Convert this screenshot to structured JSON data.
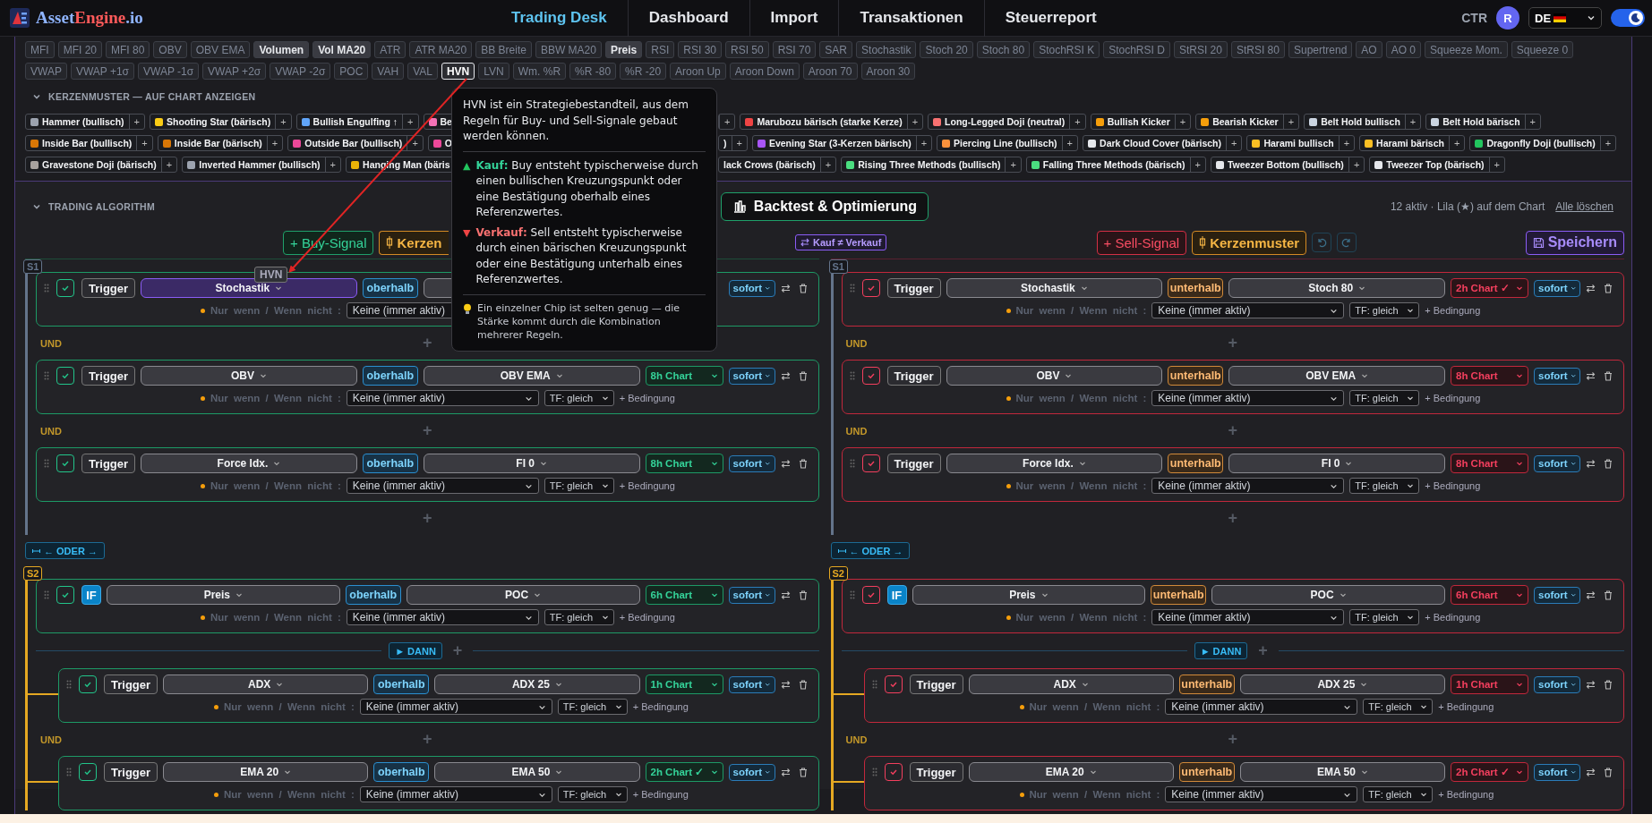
{
  "header": {
    "logo": [
      "Asset",
      "Engine",
      ".io"
    ],
    "nav": [
      {
        "label": "Trading Desk",
        "selected": true
      },
      {
        "label": "Dashboard",
        "selected": false
      },
      {
        "label": "Import",
        "selected": false
      },
      {
        "label": "Transaktionen",
        "selected": false
      },
      {
        "label": "Steuerreport",
        "selected": false
      }
    ],
    "user_code": "CTR",
    "avatar": "R",
    "language": "DE",
    "dark_mode": true
  },
  "indicator_rows": [
    [
      {
        "label": "MFI",
        "active": false,
        "selected": false
      },
      {
        "label": "MFI 20",
        "active": false,
        "selected": false
      },
      {
        "label": "MFI 80",
        "active": false,
        "selected": false
      },
      {
        "label": "OBV",
        "active": false,
        "selected": false
      },
      {
        "label": "OBV EMA",
        "active": false,
        "selected": false
      },
      {
        "label": "Volumen",
        "active": true,
        "selected": false
      },
      {
        "label": "Vol MA20",
        "active": true,
        "selected": false
      },
      {
        "label": "ATR",
        "active": false,
        "selected": false
      },
      {
        "label": "ATR MA20",
        "active": false,
        "selected": false
      },
      {
        "label": "BB Breite",
        "active": false,
        "selected": false
      },
      {
        "label": "BBW MA20",
        "active": false,
        "selected": false
      },
      {
        "label": "Preis",
        "active": true,
        "selected": false
      },
      {
        "label": "RSI",
        "active": false,
        "selected": false
      },
      {
        "label": "RSI 30",
        "active": false,
        "selected": false
      },
      {
        "label": "RSI 50",
        "active": false,
        "selected": false
      },
      {
        "label": "RSI 70",
        "active": false,
        "selected": false
      },
      {
        "label": "SAR",
        "active": false,
        "selected": false
      },
      {
        "label": "Stochastik",
        "active": false,
        "selected": false
      },
      {
        "label": "Stoch 20",
        "active": false,
        "selected": false
      },
      {
        "label": "Stoch 80",
        "active": false,
        "selected": false
      },
      {
        "label": "StochRSI K",
        "active": false,
        "selected": false
      },
      {
        "label": "StochRSI D",
        "active": false,
        "selected": false
      },
      {
        "label": "StRSI 20",
        "active": false,
        "selected": false
      },
      {
        "label": "StRSI 80",
        "active": false,
        "selected": false
      },
      {
        "label": "Supertrend",
        "active": false,
        "selected": false
      },
      {
        "label": "AO",
        "active": false,
        "selected": false
      },
      {
        "label": "AO 0",
        "active": false,
        "selected": false
      },
      {
        "label": "Squeeze Mom.",
        "active": false,
        "selected": false
      },
      {
        "label": "Squeeze 0",
        "active": false,
        "selected": false
      }
    ],
    [
      {
        "label": "VWAP",
        "active": false,
        "selected": false
      },
      {
        "label": "VWAP +1σ",
        "active": false,
        "selected": false
      },
      {
        "label": "VWAP -1σ",
        "active": false,
        "selected": false
      },
      {
        "label": "VWAP +2σ",
        "active": false,
        "selected": false
      },
      {
        "label": "VWAP -2σ",
        "active": false,
        "selected": false
      },
      {
        "label": "POC",
        "active": false,
        "selected": false
      },
      {
        "label": "VAH",
        "active": false,
        "selected": false
      },
      {
        "label": "VAL",
        "active": false,
        "selected": false
      },
      {
        "label": "HVN",
        "active": false,
        "selected": true
      },
      {
        "label": "LVN",
        "active": false,
        "selected": false
      },
      {
        "label": "Wm. %R",
        "active": false,
        "selected": false
      },
      {
        "label": "%R -80",
        "active": false,
        "selected": false
      },
      {
        "label": "%R -20",
        "active": false,
        "selected": false
      },
      {
        "label": "Aroon Up",
        "active": false,
        "selected": false
      },
      {
        "label": "Aroon Down",
        "active": false,
        "selected": false
      },
      {
        "label": "Aroon 70",
        "active": false,
        "selected": false
      },
      {
        "label": "Aroon 30",
        "active": false,
        "selected": false
      }
    ]
  ],
  "patterns": {
    "title": "KERZENMUSTER — AUF CHART ANZEIGEN",
    "expanded": true,
    "rows": [
      {
        "before": [
          {
            "label": "Hammer (bullisch)",
            "color": "#9ca3af",
            "add": "+"
          },
          {
            "label": "Shooting Star (bärisch)",
            "color": "#facc15",
            "add": "+"
          },
          {
            "label": "Bullish Engulfing ↑",
            "color": "#60a5fa",
            "add": "+"
          },
          {
            "label": "Be",
            "color": "#f472b6"
          }
        ],
        "after": [
          {
            "add": "+"
          },
          {
            "label": "Marubozu bärisch (starke Kerze)",
            "color": "#ef4444",
            "add": "+"
          },
          {
            "label": "Long-Legged Doji (neutral)",
            "color": "#f87171",
            "add": "+"
          },
          {
            "label": "Bullish Kicker",
            "color": "#f59e0b",
            "add": "+"
          },
          {
            "label": "Bearish Kicker",
            "color": "#f59e0b",
            "add": "+"
          },
          {
            "label": "Belt Hold bullisch",
            "color": "#cbd5e1",
            "add": "+"
          },
          {
            "label": "Belt Hold bärisch",
            "color": "#cbd5e1",
            "add": "+"
          }
        ]
      },
      {
        "before": [
          {
            "label": "Inside Bar (bullisch)",
            "color": "#d97706",
            "add": "+"
          },
          {
            "label": "Inside Bar (bärisch)",
            "color": "#d97706",
            "add": "+"
          },
          {
            "label": "Outside Bar (bullisch)",
            "color": "#ec4899",
            "add": "+"
          },
          {
            "label": "O",
            "color": "#ec4899"
          }
        ],
        "after": [
          {
            "label": ")",
            "add": "+"
          },
          {
            "label": "Evening Star (3-Kerzen bärisch)",
            "color": "#a855f7",
            "add": "+"
          },
          {
            "label": "Piercing Line (bullisch)",
            "color": "#fb923c",
            "add": "+"
          },
          {
            "label": "Dark Cloud Cover (bärisch)",
            "color": "#e5e7eb",
            "add": "+"
          },
          {
            "label": "Harami bullisch",
            "color": "#fbbf24",
            "add": "+"
          },
          {
            "label": "Harami bärisch",
            "color": "#fbbf24",
            "add": "+"
          },
          {
            "label": "Dragonfly Doji (bullisch)",
            "color": "#22c55e",
            "add": "+"
          }
        ]
      },
      {
        "before": [
          {
            "label": "Gravestone Doji (bärisch)",
            "color": "#a8a29e",
            "add": "+"
          },
          {
            "label": "Inverted Hammer (bullisch)",
            "color": "#9ca3af",
            "add": "+"
          },
          {
            "label": "Hanging Man (bäris",
            "color": "#eab308"
          }
        ],
        "after": [
          {
            "label": "lack Crows (bärisch)",
            "add": "+"
          },
          {
            "label": "Rising Three Methods (bullisch)",
            "color": "#4ade80",
            "add": "+"
          },
          {
            "label": "Falling Three Methods (bärisch)",
            "color": "#4ade80",
            "add": "+"
          },
          {
            "label": "Tweezer Bottom (bullisch)",
            "color": "#e5e7eb",
            "add": "+"
          },
          {
            "label": "Tweezer Top (bärisch)",
            "color": "#e5e7eb",
            "add": "+"
          }
        ]
      }
    ]
  },
  "tooltip": {
    "intro": "HVN ist ein Strategiebestandteil, aus dem Regeln für Buy- und Sell-Signale gebaut werden können.",
    "buy": {
      "marker": "▲",
      "label": "Kauf:",
      "text": "Buy entsteht typischerweise durch einen bullischen Kreuzungspunkt oder eine Bestätigung oberhalb eines Referenzwertes."
    },
    "sell": {
      "marker": "▼",
      "label": "Verkauf:",
      "text": "Sell entsteht typischerweise durch einen bärischen Kreuzungspunkt oder eine Bestätigung unterhalb eines Referenzwertes."
    },
    "tip": "Ein einzelner Chip ist selten genug — die Stärke kommt durch die Kombination mehrerer Regeln."
  },
  "drag_ghost": "HVN",
  "algorithm": {
    "title": "TRADING ALGORITHM",
    "expanded": true,
    "backtest": "Backtest & Optimierung",
    "status": "12 aktiv · Lila (★) auf dem Chart",
    "clear": "Alle löschen",
    "compare": "Kauf ≠ Verkauf",
    "columns": [
      {
        "kind": "buy",
        "signal": "+ Buy-Signal",
        "pattern": "Kerzen",
        "history": false,
        "groups": [
          {
            "label": "S1",
            "color": "#64748b",
            "items": [
              {
                "kind": "trigger",
                "enabled": true,
                "label": "Trigger",
                "indicator": "Stochastik",
                "highlighted": true,
                "relation": "oberhalb",
                "timing": "sofort",
                "mode": "Nur wenn / Wenn nicht :",
                "condition": "Keine (immer aktiv)"
              },
              {
                "kind": "and",
                "label": "UND",
                "add": "+"
              },
              {
                "kind": "trigger",
                "enabled": true,
                "label": "Trigger",
                "indicator": "OBV",
                "highlighted": false,
                "relation": "oberhalb",
                "target": "OBV EMA",
                "chart": "8h Chart",
                "timing": "sofort",
                "mode": "Nur wenn / Wenn nicht :",
                "condition": "Keine (immer aktiv)",
                "timeframe": "TF: gleich",
                "add_condition": "+ Bedingung"
              },
              {
                "kind": "and",
                "label": "UND",
                "add": "+"
              },
              {
                "kind": "trigger",
                "enabled": true,
                "label": "Trigger",
                "indicator": "Force Idx.",
                "highlighted": false,
                "relation": "oberhalb",
                "target": "FI 0",
                "chart": "8h Chart",
                "timing": "sofort",
                "mode": "Nur wenn / Wenn nicht :",
                "condition": "Keine (immer aktiv)",
                "timeframe": "TF: gleich",
                "add_condition": "+ Bedingung"
              },
              {
                "kind": "add",
                "add": "+"
              }
            ]
          },
          {
            "label": "S2",
            "color": "#e5a822",
            "or_label": "← ODER →",
            "items": [
              {
                "kind": "if",
                "enabled": true,
                "label": "IF",
                "indicator": "Preis",
                "highlighted": false,
                "relation": "oberhalb",
                "target": "POC",
                "chart": "6h Chart",
                "timing": "sofort",
                "mode": "Nur wenn / Wenn nicht :",
                "condition": "Keine (immer aktiv)",
                "timeframe": "TF: gleich",
                "add_condition": "+ Bedingung",
                "then": {
                  "label": "► DANN",
                  "add": "+"
                },
                "children": [
                  {
                    "kind": "trigger",
                    "enabled": true,
                    "label": "Trigger",
                    "indicator": "ADX",
                    "highlighted": false,
                    "relation": "oberhalb",
                    "target": "ADX 25",
                    "chart": "1h Chart",
                    "timing": "sofort",
                    "mode": "Nur wenn / Wenn nicht :",
                    "condition": "Keine (immer aktiv)",
                    "timeframe": "TF: gleich",
                    "add_condition": "+ Bedingung"
                  },
                  {
                    "kind": "and",
                    "label": "UND",
                    "add": "+"
                  },
                  {
                    "kind": "trigger",
                    "enabled": true,
                    "label": "Trigger",
                    "indicator": "EMA 20",
                    "highlighted": false,
                    "relation": "oberhalb",
                    "target": "EMA 50",
                    "chart": "2h Chart ✓",
                    "timing": "sofort",
                    "mode": "Nur wenn / Wenn nicht :",
                    "condition": "Keine (immer aktiv)",
                    "timeframe": "TF: gleich",
                    "add_condition": "+ Bedingung"
                  }
                ]
              }
            ]
          }
        ]
      },
      {
        "kind": "sell",
        "signal": "+ Sell-Signal",
        "pattern": "Kerzenmuster",
        "history": true,
        "save": "Speichern",
        "groups": [
          {
            "label": "S1",
            "color": "#64748b",
            "items": [
              {
                "kind": "trigger",
                "enabled": true,
                "label": "Trigger",
                "indicator": "Stochastik",
                "highlighted": false,
                "relation": "unterhalb",
                "target": "Stoch 80",
                "chart": "2h Chart ✓",
                "timing": "sofort",
                "mode": "Nur wenn / Wenn nicht :",
                "condition": "Keine (immer aktiv)",
                "timeframe": "TF: gleich",
                "add_condition": "+ Bedingung"
              },
              {
                "kind": "and",
                "label": "UND",
                "add": "+"
              },
              {
                "kind": "trigger",
                "enabled": true,
                "label": "Trigger",
                "indicator": "OBV",
                "highlighted": false,
                "relation": "unterhalb",
                "target": "OBV EMA",
                "chart": "8h Chart",
                "timing": "sofort",
                "mode": "Nur wenn / Wenn nicht :",
                "condition": "Keine (immer aktiv)",
                "timeframe": "TF: gleich",
                "add_condition": "+ Bedingung"
              },
              {
                "kind": "and",
                "label": "UND",
                "add": "+"
              },
              {
                "kind": "trigger",
                "enabled": true,
                "label": "Trigger",
                "indicator": "Force Idx.",
                "highlighted": false,
                "relation": "unterhalb",
                "target": "FI 0",
                "chart": "8h Chart",
                "timing": "sofort",
                "mode": "Nur wenn / Wenn nicht :",
                "condition": "Keine (immer aktiv)",
                "timeframe": "TF: gleich",
                "add_condition": "+ Bedingung"
              },
              {
                "kind": "add",
                "add": "+"
              }
            ]
          },
          {
            "label": "S2",
            "color": "#e5a822",
            "or_label": "← ODER →",
            "items": [
              {
                "kind": "if",
                "enabled": true,
                "label": "IF",
                "indicator": "Preis",
                "highlighted": false,
                "relation": "unterhalb",
                "target": "POC",
                "chart": "6h Chart",
                "timing": "sofort",
                "mode": "Nur wenn / Wenn nicht :",
                "condition": "Keine (immer aktiv)",
                "timeframe": "TF: gleich",
                "add_condition": "+ Bedingung",
                "then": {
                  "label": "► DANN",
                  "add": "+"
                },
                "children": [
                  {
                    "kind": "trigger",
                    "enabled": true,
                    "label": "Trigger",
                    "indicator": "ADX",
                    "highlighted": false,
                    "relation": "unterhalb",
                    "target": "ADX 25",
                    "chart": "1h Chart",
                    "timing": "sofort",
                    "mode": "Nur wenn / Wenn nicht :",
                    "condition": "Keine (immer aktiv)",
                    "timeframe": "TF: gleich",
                    "add_condition": "+ Bedingung"
                  },
                  {
                    "kind": "and",
                    "label": "UND",
                    "add": "+"
                  },
                  {
                    "kind": "trigger",
                    "enabled": true,
                    "label": "Trigger",
                    "indicator": "EMA 20",
                    "highlighted": false,
                    "relation": "unterhalb",
                    "target": "EMA 50",
                    "chart": "2h Chart ✓",
                    "timing": "sofort",
                    "mode": "Nur wenn / Wenn nicht :",
                    "condition": "Keine (immer aktiv)",
                    "timeframe": "TF: gleich",
                    "add_condition": "+ Bedingung"
                  }
                ]
              }
            ]
          }
        ]
      }
    ]
  }
}
